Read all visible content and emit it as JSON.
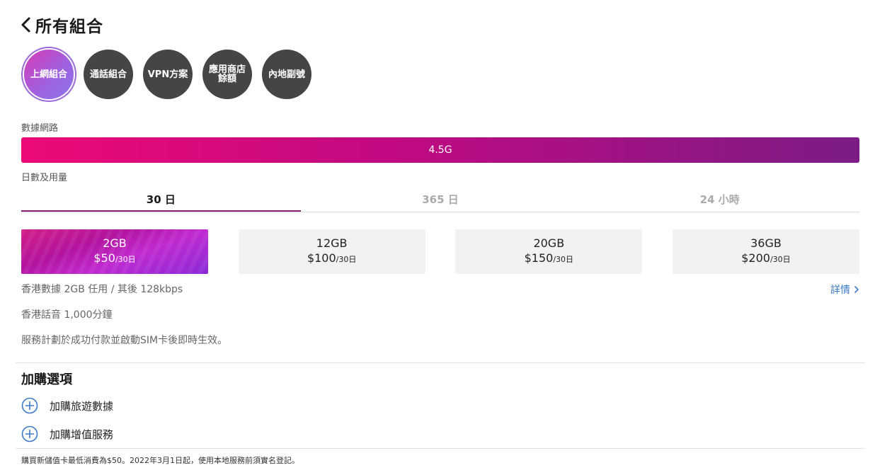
{
  "header": {
    "title": "所有組合"
  },
  "categories": [
    {
      "label": "上網組合",
      "active": true
    },
    {
      "label": "通話組合",
      "active": false
    },
    {
      "label": "VPN方案",
      "active": false
    },
    {
      "label": "應用商店\n餘額",
      "active": false
    },
    {
      "label": "內地副號",
      "active": false
    }
  ],
  "network": {
    "label": "數據網路",
    "value": "4.5G"
  },
  "days": {
    "label": "日數及用量",
    "tabs": [
      {
        "label": "30 日",
        "active": true
      },
      {
        "label": "365 日",
        "active": false
      },
      {
        "label": "24 小時",
        "active": false
      }
    ]
  },
  "plans": [
    {
      "size": "2GB",
      "price": "$50",
      "unit": "/30日",
      "selected": true
    },
    {
      "size": "12GB",
      "price": "$100",
      "unit": "/30日",
      "selected": false
    },
    {
      "size": "20GB",
      "price": "$150",
      "unit": "/30日",
      "selected": false
    },
    {
      "size": "36GB",
      "price": "$200",
      "unit": "/30日",
      "selected": false
    }
  ],
  "plan_info": {
    "line1": "香港數據 2GB 任用 / 其後 128kbps",
    "line2": "香港話音 1,000分鐘",
    "line3": "服務計劃於成功付款並啟動SIM卡後即時生效。",
    "details_label": "詳情"
  },
  "addons": {
    "title": "加購選項",
    "items": [
      {
        "label": "加購旅遊數據"
      },
      {
        "label": "加購增值服務"
      }
    ]
  },
  "footer": {
    "note": "購買新儲值卡最低消費為$50。2022年3月1日起，使用本地服務前須實名登記。"
  },
  "colors": {
    "accent": "#8a1f7e",
    "link": "#3a7bc8",
    "brand_pink": "#ec0a78",
    "brand_purple": "#7b1c86",
    "category_bg": "#454545"
  },
  "icons": {
    "back": "chevron-left-icon",
    "details": "chevron-right-icon",
    "addon": "plus-circle-icon"
  }
}
